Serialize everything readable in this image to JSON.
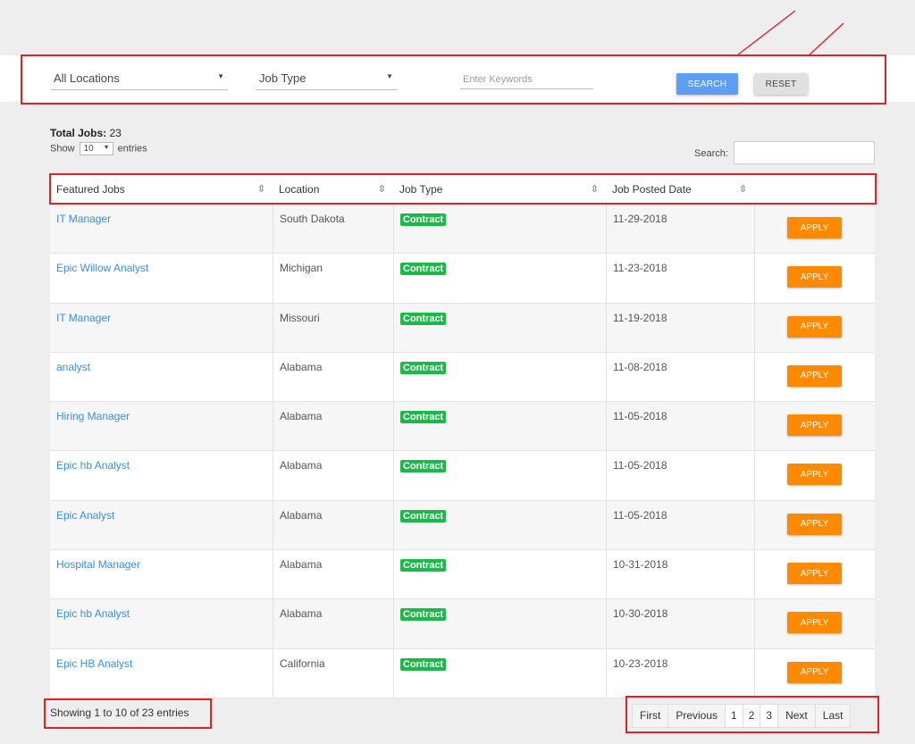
{
  "filters": {
    "location": "All Locations",
    "job_type": "Job Type",
    "keywords_placeholder": "Enter Keywords",
    "search_label": "SEARCH",
    "reset_label": "RESET"
  },
  "summary": {
    "total_label": "Total Jobs:",
    "total_value": "23",
    "show_label": "Show",
    "page_length": "10",
    "entries_label": "entries",
    "search_label": "Search:"
  },
  "table": {
    "headers": [
      "Featured Jobs",
      "Location",
      "Job Type",
      "Job Posted Date",
      ""
    ],
    "rows": [
      {
        "title": "IT Manager",
        "location": "South Dakota",
        "type": "Contract",
        "date": "11-29-2018",
        "action": "APPLY"
      },
      {
        "title": "Epic Willow Analyst",
        "location": "Michigan",
        "type": "Contract",
        "date": "11-23-2018",
        "action": "APPLY"
      },
      {
        "title": "IT Manager",
        "location": "Missouri",
        "type": "Contract",
        "date": "11-19-2018",
        "action": "APPLY"
      },
      {
        "title": "analyst",
        "location": "Alabama",
        "type": "Contract",
        "date": "11-08-2018",
        "action": "APPLY"
      },
      {
        "title": "Hiring Manager",
        "location": "Alabama",
        "type": "Contract",
        "date": "11-05-2018",
        "action": "APPLY"
      },
      {
        "title": "Epic hb Analyst",
        "location": "Alabama",
        "type": "Contract",
        "date": "11-05-2018",
        "action": "APPLY"
      },
      {
        "title": "Epic Analyst",
        "location": "Alabama",
        "type": "Contract",
        "date": "11-05-2018",
        "action": "APPLY"
      },
      {
        "title": "Hospital Manager",
        "location": "Alabama",
        "type": "Contract",
        "date": "10-31-2018",
        "action": "APPLY"
      },
      {
        "title": "Epic hb Analyst",
        "location": "Alabama",
        "type": "Contract",
        "date": "10-30-2018",
        "action": "APPLY"
      },
      {
        "title": "Epic HB Analyst",
        "location": "California",
        "type": "Contract",
        "date": "10-23-2018",
        "action": "APPLY"
      }
    ]
  },
  "footer": {
    "info": "Showing 1 to 10 of 23 entries",
    "pagination": [
      "First",
      "Previous",
      "1",
      "2",
      "3",
      "Next",
      "Last"
    ]
  },
  "icons": {
    "sort": "sort-icon",
    "caret": "chevron-down-icon"
  },
  "colors": {
    "annotation_red": "#e0202b",
    "search_button": "#5b9ef2",
    "apply_button": "#ff8a00",
    "contract_badge": "#1cb84a",
    "job_link": "#3a8fd6"
  }
}
